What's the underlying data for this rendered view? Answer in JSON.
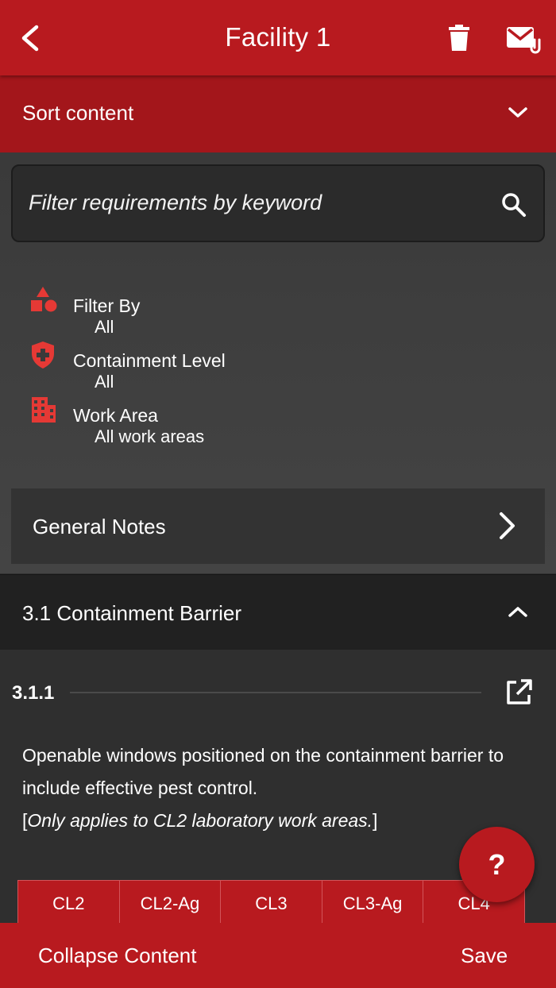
{
  "header": {
    "title": "Facility 1"
  },
  "sort": {
    "label": "Sort content"
  },
  "search": {
    "placeholder": "Filter requirements by keyword"
  },
  "filters": [
    {
      "name": "Filter By",
      "value": "All",
      "icon": "shapes-icon"
    },
    {
      "name": "Containment Level",
      "value": "All",
      "icon": "shield-plus-icon"
    },
    {
      "name": "Work Area",
      "value": "All work areas",
      "icon": "building-icon"
    }
  ],
  "general_notes": {
    "label": "General Notes"
  },
  "section": {
    "title": "3.1 Containment Barrier"
  },
  "requirement": {
    "number": "3.1.1",
    "text": "Openable windows positioned on the containment barrier to include effective pest control.",
    "note_open": "[",
    "note_italic": "Only applies to CL2 laboratory work areas.",
    "note_close": "]"
  },
  "cl_tabs": [
    "CL2",
    "CL2-Ag",
    "CL3",
    "CL3-Ag",
    "CL4"
  ],
  "help": {
    "label": "?"
  },
  "footer": {
    "collapse": "Collapse Content",
    "save": "Save"
  },
  "colors": {
    "brand_red": "#b81a1f",
    "dark_red": "#a3161b",
    "accent_icon": "#e53935"
  }
}
